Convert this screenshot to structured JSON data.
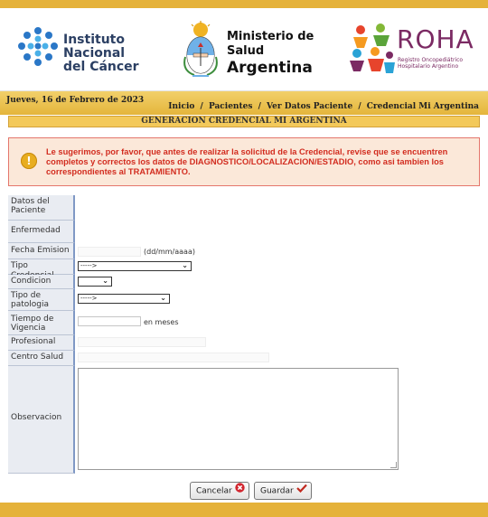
{
  "logos": {
    "inc": {
      "line1": "Instituto Nacional",
      "line2": "del Cáncer"
    },
    "ministerio": {
      "line1": "Ministerio de Salud",
      "line2": "Argentina"
    },
    "roha": {
      "big": "ROHA",
      "small1": "Registro Oncopediátrico",
      "small2": "Hospitalario Argentino"
    }
  },
  "infobar": {
    "date": "Jueves, 16 de Febrero de 2023",
    "breadcrumbs": [
      "Inicio",
      "Pacientes",
      "Ver Datos Paciente",
      "Credencial Mi Argentina"
    ],
    "separator": "/"
  },
  "section_title": "GENERACION CREDENCIAL MI ARGENTINA",
  "warning": {
    "icon": "exclamation-icon",
    "text": "Le sugerimos, por favor, que antes de realizar la solicitud de la Credencial, revise que se encuentren completos y correctos los datos de DIAGNOSTICO/LOCALIZACION/ESTADIO, como asi tambien los correspondientes al TRATAMIENTO."
  },
  "form": {
    "datos_paciente": {
      "label": "Datos del Paciente"
    },
    "enfermedad": {
      "label": "Enfermedad"
    },
    "fecha_emision": {
      "label": "Fecha Emision",
      "value": "",
      "hint": "(dd/mm/aaaa)"
    },
    "tipo_credencial": {
      "label": "Tipo Credencial",
      "selected": "----->"
    },
    "condicion": {
      "label": "Condicion",
      "selected": ""
    },
    "tipo_patologia": {
      "label": "Tipo de patologia",
      "selected": "----->"
    },
    "tiempo_vigencia": {
      "label": "Tiempo de Vigencia",
      "value": "",
      "hint": "en meses"
    },
    "profesional": {
      "label": "Profesional",
      "value": ""
    },
    "centro_salud": {
      "label": "Centro Salud",
      "value": ""
    },
    "observacion": {
      "label": "Observacion",
      "value": ""
    }
  },
  "buttons": {
    "cancel": {
      "label": "Cancelar",
      "icon": "cancel-icon",
      "color": "#d2262f"
    },
    "save": {
      "label": "Guardar",
      "icon": "checkmark-icon",
      "color": "#c0281e"
    }
  },
  "colors": {
    "accent": "#e5b23a",
    "label_bg": "#e9ecf2",
    "label_border": "#7f98c5",
    "warning_text": "#d22c1f",
    "warning_bg": "#fbe8d9"
  }
}
